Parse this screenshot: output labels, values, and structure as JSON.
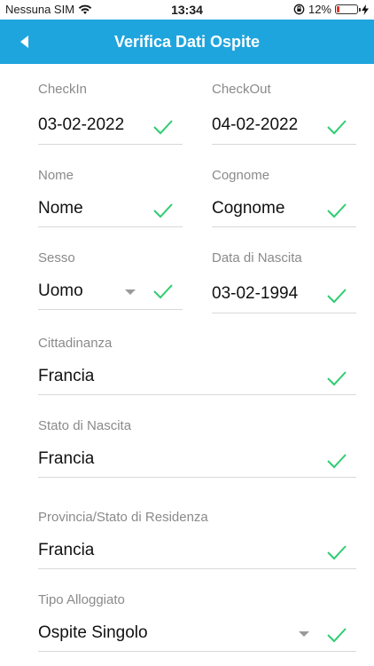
{
  "status_bar": {
    "carrier": "Nessuna SIM",
    "time": "13:34",
    "battery": "12%"
  },
  "nav": {
    "title": "Verifica Dati Ospite"
  },
  "colors": {
    "nav_bg": "#1fa5de",
    "check": "#2ecc71"
  },
  "fields": {
    "checkin": {
      "label": "CheckIn",
      "value": "03-02-2022"
    },
    "checkout": {
      "label": "CheckOut",
      "value": "04-02-2022"
    },
    "nome": {
      "label": "Nome",
      "value": "Nome"
    },
    "cognome": {
      "label": "Cognome",
      "value": "Cognome"
    },
    "sesso": {
      "label": "Sesso",
      "value": "Uomo"
    },
    "data_nascita": {
      "label": "Data di Nascita",
      "value": "03-02-1994"
    },
    "cittadinanza": {
      "label": "Cittadinanza",
      "value": "Francia"
    },
    "stato_nascita": {
      "label": "Stato di Nascita",
      "value": "Francia"
    },
    "provincia_residenza": {
      "label": "Provincia/Stato di Residenza",
      "value": "Francia"
    },
    "tipo_alloggiato": {
      "label": "Tipo Alloggiato",
      "value": "Ospite Singolo"
    }
  }
}
